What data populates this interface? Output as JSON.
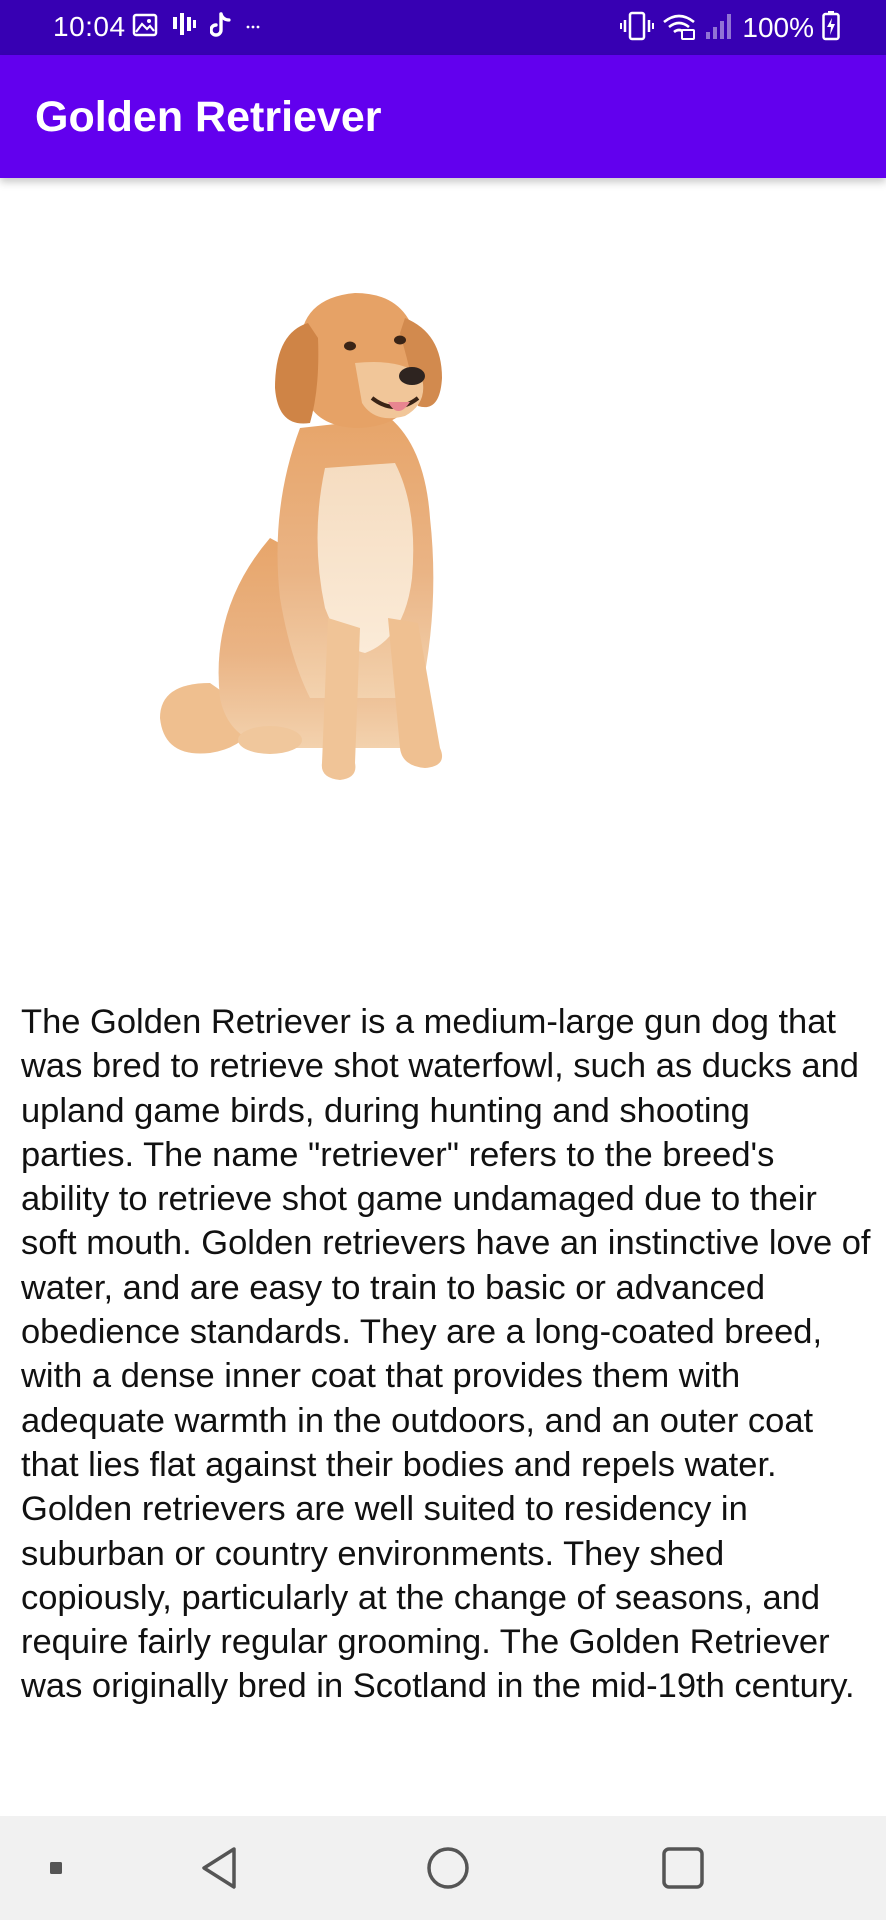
{
  "status_bar": {
    "time": "10:04",
    "battery": "100%",
    "left_icons": [
      "gallery-icon",
      "signal-bars-icon",
      "tiktok-icon",
      "more-dots-icon"
    ],
    "right_icons": [
      "vibrate-icon",
      "wifi-icon",
      "cell-signal-icon",
      "battery-charging-icon"
    ]
  },
  "app_bar": {
    "title": "Golden Retriever"
  },
  "main": {
    "image_subject": "golden-retriever-dog",
    "description": "The Golden Retriever is a medium-large gun dog that was bred to retrieve shot waterfowl, such as ducks and upland game birds, during hunting and shooting parties. The name \"retriever\" refers to the breed's ability to retrieve shot game undamaged due to their soft mouth. Golden retrievers have an instinctive love of water, and are easy to train to basic or advanced obedience standards. They are a long-coated breed, with a dense inner coat that provides them with adequate warmth in the outdoors, and an outer coat that lies flat against their bodies and repels water. Golden retrievers are well suited to residency in suburban or country environments. They shed copiously, particularly at the change of seasons, and require fairly regular grooming. The Golden Retriever was originally bred in Scotland in the mid-19th century."
  },
  "nav_bar": {
    "buttons": [
      "menu-dot-icon",
      "back-icon",
      "home-icon",
      "recents-icon"
    ]
  },
  "colors": {
    "status_bar": "#3700b3",
    "app_bar": "#6200ee",
    "nav_bar": "#f1f1f1",
    "text": "#111111"
  }
}
